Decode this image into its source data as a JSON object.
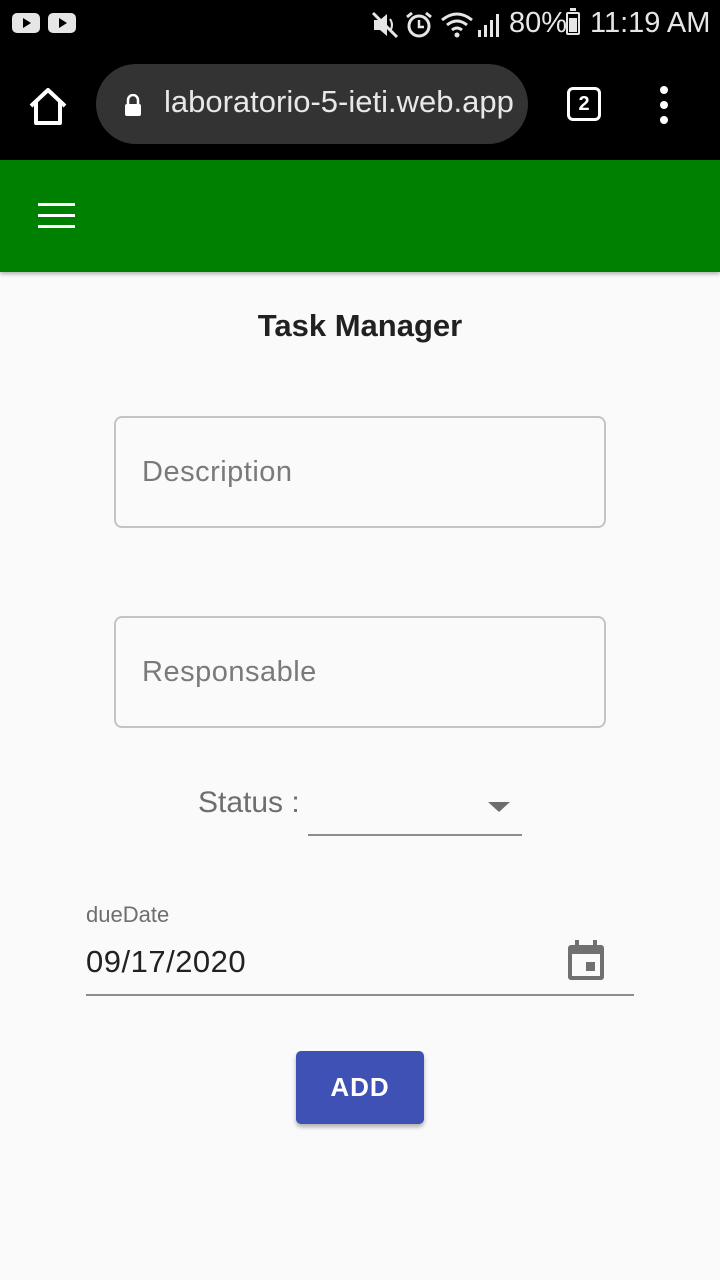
{
  "status_bar": {
    "battery_percent": "80%",
    "time": "11:19 AM",
    "icons": [
      "youtube-icon",
      "youtube-icon",
      "mute-icon",
      "alarm-icon",
      "wifi-icon",
      "signal-icon",
      "battery-icon"
    ]
  },
  "browser": {
    "url": "laboratorio-5-ieti.web.app",
    "tab_count": "2",
    "icons": [
      "home-icon",
      "lock-icon",
      "tabs-icon",
      "more-vert-icon"
    ]
  },
  "app_bar": {
    "color": "#008000",
    "menu_icon": "hamburger-menu-icon"
  },
  "form": {
    "title": "Task Manager",
    "description_placeholder": "Description",
    "description_value": "",
    "responsable_placeholder": "Responsable",
    "responsable_value": "",
    "status_label": "Status :",
    "status_value": "",
    "due_date_label": "dueDate",
    "due_date_value": "09/17/2020",
    "add_label": "ADD",
    "add_color": "#3f51b5"
  }
}
